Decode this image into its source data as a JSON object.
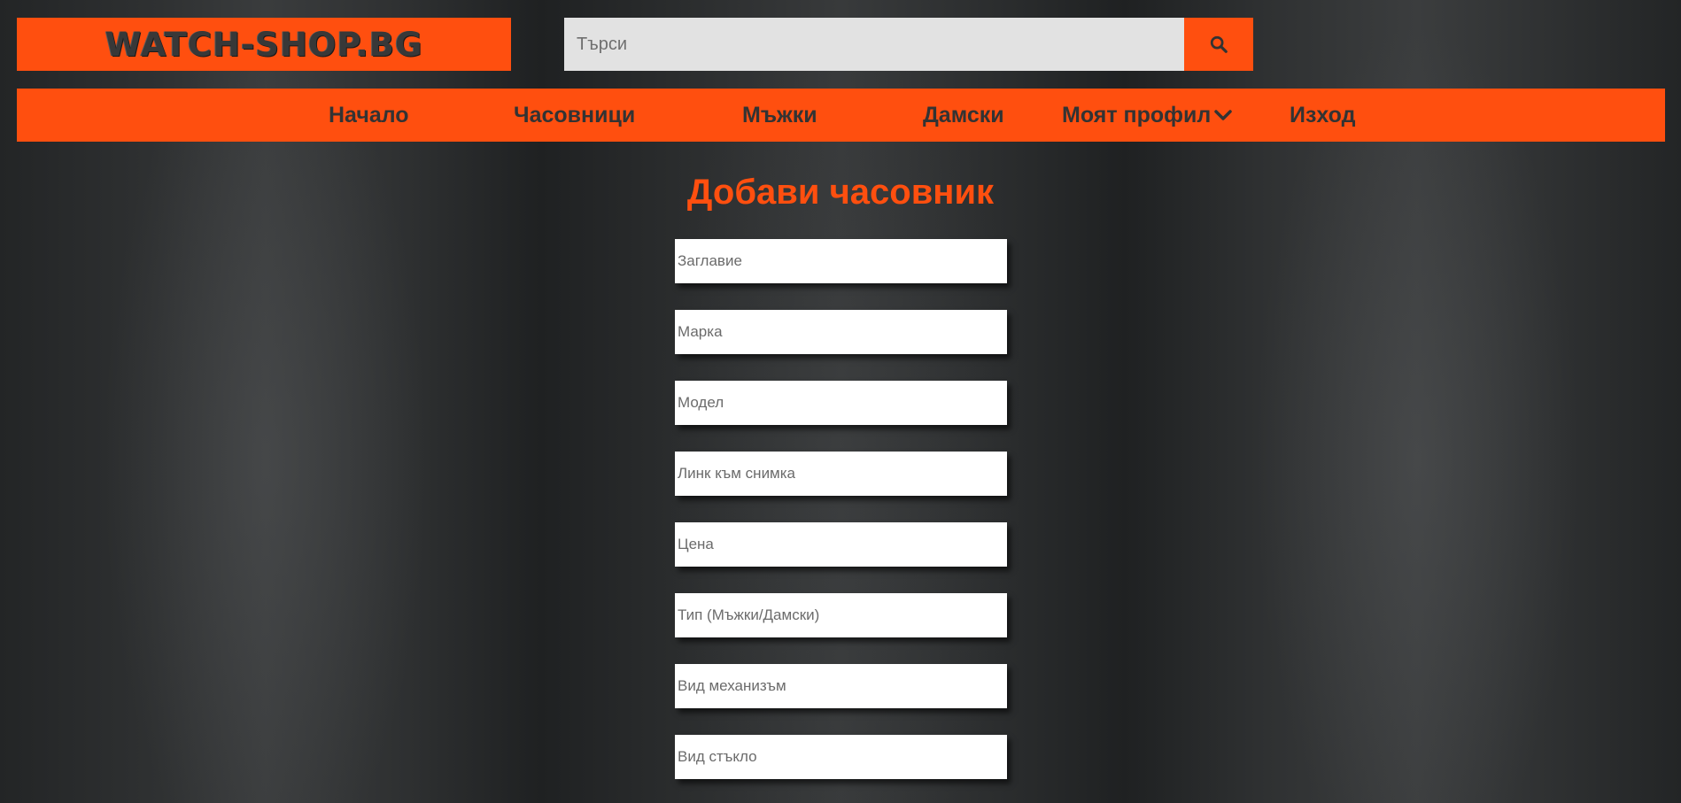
{
  "header": {
    "logo_text": "WATCH-SHOP.BG",
    "search_placeholder": "Търси",
    "search_icon": "search-icon"
  },
  "nav": {
    "items": [
      {
        "label": "Начало"
      },
      {
        "label": "Часовници"
      },
      {
        "label": "Мъжки"
      },
      {
        "label": "Дамски"
      },
      {
        "label": "Моят профил",
        "icon": "chevron-down-icon"
      },
      {
        "label": "Изход"
      }
    ]
  },
  "main": {
    "title": "Добави часовник",
    "fields": [
      {
        "placeholder": "Заглавие",
        "value": ""
      },
      {
        "placeholder": "Марка",
        "value": ""
      },
      {
        "placeholder": "Модел",
        "value": ""
      },
      {
        "placeholder": "Линк към снимка",
        "value": ""
      },
      {
        "placeholder": "Цена",
        "value": ""
      },
      {
        "placeholder": "Тип (Мъжки/Дамски)",
        "value": ""
      },
      {
        "placeholder": "Вид механизъм",
        "value": ""
      },
      {
        "placeholder": "Вид стъкло",
        "value": ""
      }
    ]
  },
  "colors": {
    "accent": "#ff4f0f",
    "nav_text": "#333333",
    "background": "#2a2c2d",
    "search_bg": "#e2e2e2",
    "field_bg": "#ffffff"
  }
}
